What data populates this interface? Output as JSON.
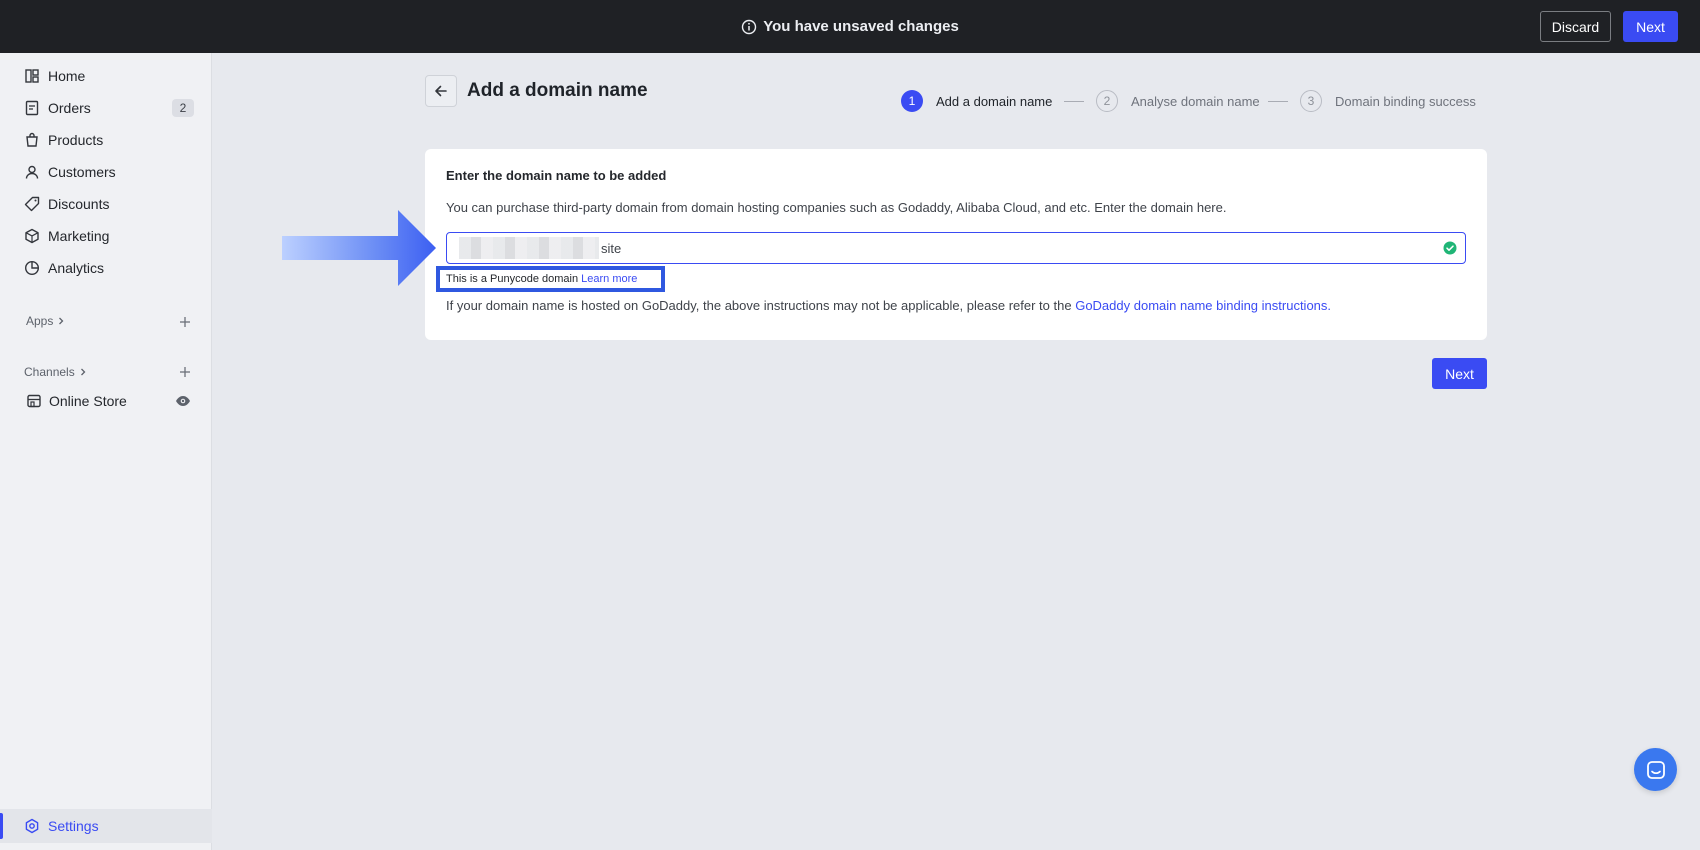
{
  "topbar": {
    "notice": "You have unsaved changes",
    "discard_label": "Discard",
    "next_label": "Next"
  },
  "sidebar": {
    "items": [
      {
        "label": "Home",
        "icon": "home-icon"
      },
      {
        "label": "Orders",
        "icon": "orders-icon",
        "badge": "2"
      },
      {
        "label": "Products",
        "icon": "products-icon"
      },
      {
        "label": "Customers",
        "icon": "customers-icon"
      },
      {
        "label": "Discounts",
        "icon": "discounts-icon"
      },
      {
        "label": "Marketing",
        "icon": "marketing-icon"
      },
      {
        "label": "Analytics",
        "icon": "analytics-icon"
      }
    ],
    "apps_label": "Apps",
    "channels_label": "Channels",
    "online_store_label": "Online Store",
    "settings_label": "Settings"
  },
  "header": {
    "title": "Add a domain name"
  },
  "steps": [
    {
      "number": "1",
      "label": "Add a domain name",
      "state": "active"
    },
    {
      "number": "2",
      "label": "Analyse domain name",
      "state": "idle"
    },
    {
      "number": "3",
      "label": "Domain binding success",
      "state": "idle"
    }
  ],
  "card": {
    "title": "Enter the domain name to be added",
    "description": "You can purchase third-party domain from domain hosting companies such as Godaddy, Alibaba Cloud, and etc. Enter the domain here.",
    "input_value_suffix": "site",
    "punycode_text": "This is a Punycode domain",
    "learn_more": "Learn more",
    "godaddy_text": "If your domain name is hosted on GoDaddy, the above instructions may not be applicable, please refer to the",
    "godaddy_link": "GoDaddy domain name binding instructions."
  },
  "footer": {
    "next_label": "Next"
  },
  "colors": {
    "accent": "#3a4bf3",
    "topbar": "#1f2125",
    "success": "#1fb576",
    "highlight": "#2f58e0"
  }
}
